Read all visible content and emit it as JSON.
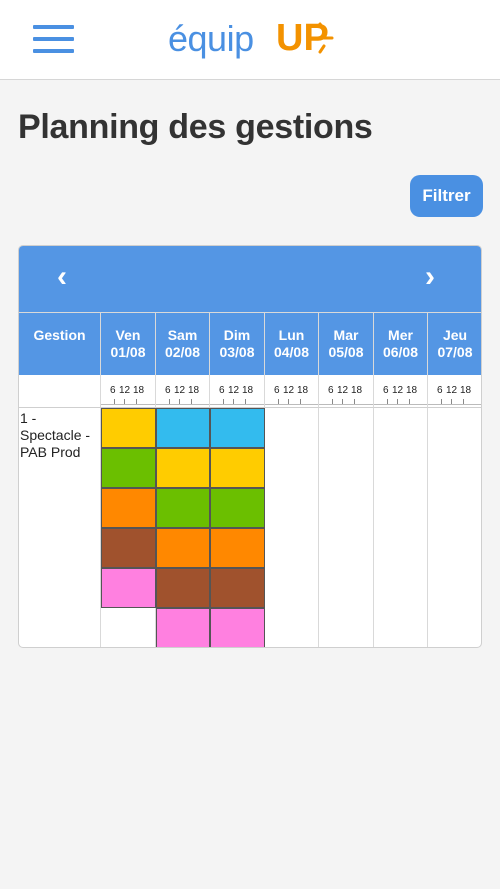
{
  "header": {
    "menu_icon": "hamburger-menu-icon",
    "logo": {
      "part1": "équip",
      "part2": "UP",
      "sun_icon": "sun-rays-icon"
    }
  },
  "page": {
    "title": "Planning des gestions",
    "filter_label": "Filtrer"
  },
  "planning": {
    "prev_label": "‹",
    "next_label": "›",
    "gestion_header": "Gestion",
    "tick_labels": [
      "6",
      "12",
      "18"
    ],
    "days": [
      {
        "name": "Ven",
        "date": "01/08",
        "blocks": [
          "#ffcc00",
          "#6bbf00",
          "#ff8800",
          "#a0522d",
          "#ff80e0"
        ]
      },
      {
        "name": "Sam",
        "date": "02/08",
        "blocks": [
          "#33bbee",
          "#ffcc00",
          "#6bbf00",
          "#ff8800",
          "#a0522d",
          "#ff80e0"
        ]
      },
      {
        "name": "Dim",
        "date": "03/08",
        "blocks": [
          "#33bbee",
          "#ffcc00",
          "#6bbf00",
          "#ff8800",
          "#a0522d",
          "#ff80e0"
        ]
      },
      {
        "name": "Lun",
        "date": "04/08",
        "blocks": []
      },
      {
        "name": "Mar",
        "date": "05/08",
        "blocks": []
      },
      {
        "name": "Mer",
        "date": "06/08",
        "blocks": []
      },
      {
        "name": "Jeu",
        "date": "07/08",
        "blocks": []
      }
    ],
    "rows": [
      {
        "label": "1 - Spectacle - PAB Prod"
      }
    ]
  },
  "colors": {
    "primary": "#4a90e2",
    "header_blue": "#5496e4",
    "brand_orange": "#f39200"
  }
}
